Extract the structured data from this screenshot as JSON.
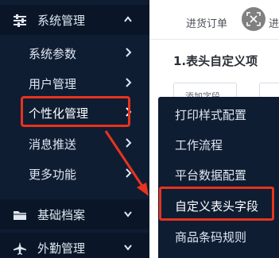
{
  "sidebar": {
    "groups": [
      {
        "label": "系统管理",
        "icon": "sliders-icon",
        "chevron": "up"
      },
      {
        "label": "基础档案",
        "icon": "folder-icon",
        "chevron": "down"
      },
      {
        "label": "外勤管理",
        "icon": "airplane-icon",
        "chevron": "down"
      }
    ],
    "items": [
      {
        "label": "系统参数"
      },
      {
        "label": "用户管理"
      },
      {
        "label": "个性化管理",
        "active": true
      },
      {
        "label": "消息推送"
      },
      {
        "label": "更多功能"
      }
    ]
  },
  "tabbar": {
    "tab_label": "进货订单",
    "tab_label_2": "进"
  },
  "main": {
    "page_title": "1.表头自定义项",
    "add_field_button": "添加字段"
  },
  "flyout": {
    "items": [
      {
        "label": "打印样式配置"
      },
      {
        "label": "工作流程"
      },
      {
        "label": "平台数据配置"
      },
      {
        "label": "自定义表头字段",
        "highlighted": true
      },
      {
        "label": "商品条码规则"
      }
    ]
  },
  "colors": {
    "sidebar_bg": "#0f1d33",
    "highlight_red": "#e8331d",
    "text_light": "#dfe6f0"
  }
}
